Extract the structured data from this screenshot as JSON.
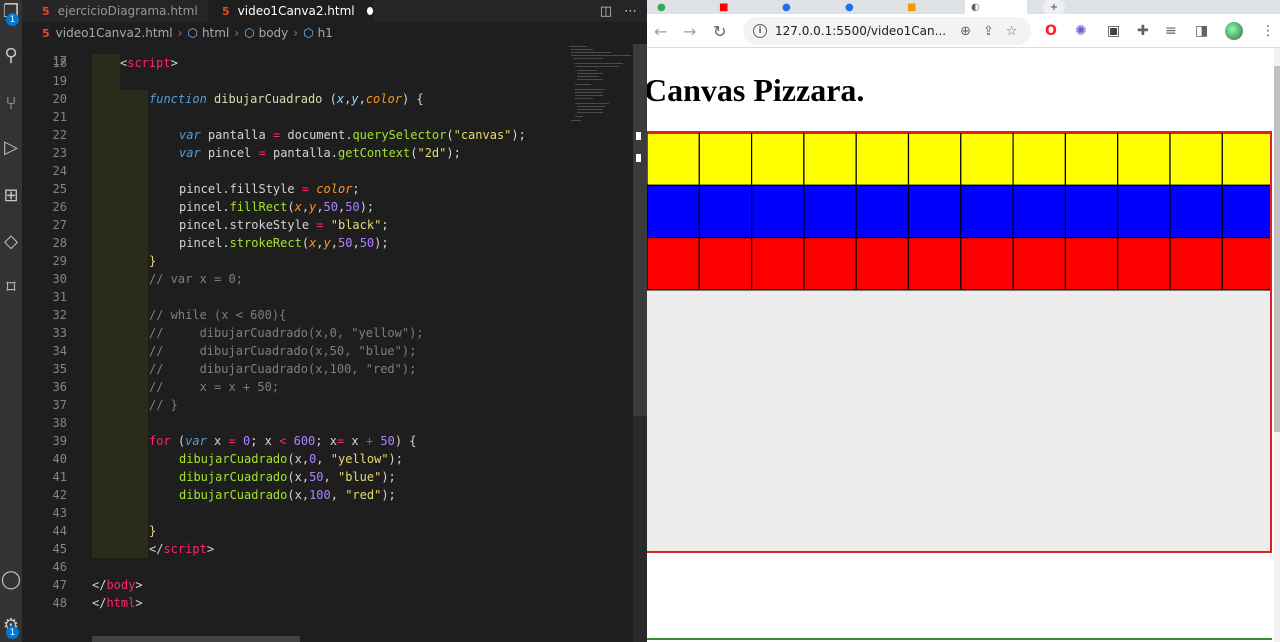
{
  "editor": {
    "tabs": [
      {
        "label": "ejercicioDiagrama.html",
        "active": false
      },
      {
        "label": "video1Canva2.html",
        "active": true,
        "modified": true
      }
    ],
    "breadcrumb": [
      "video1Canva2.html",
      "html",
      "body",
      "h1"
    ],
    "activity_badges": [
      "1",
      "1"
    ],
    "partial_top_line_number": "17",
    "lines": [
      {
        "n": "18",
        "html": "<span class='o'>&lt;</span><span class='t'>script</span><span class='o'>&gt;</span>",
        "indent": 1
      },
      {
        "n": "19",
        "html": "",
        "indent": 0
      },
      {
        "n": "20",
        "html": "<span class='k'>function</span> <span class='f'>dibujarCuadrado</span> <span class='o'>(</span><span class='p'>x</span>,<span class='p'>y</span>,<span class='p' style='color:#fd971f'>color</span><span class='o'>) {</span>",
        "indent": 2
      },
      {
        "n": "21",
        "html": "",
        "indent": 0
      },
      {
        "n": "22",
        "html": "<span class='k'>var</span> <span class='v'>pantalla</span> <span class='t'>=</span> document.<span class='m'>querySelector</span>(<span class='s' style='color:#e6db74'>\"canvas\"</span>);",
        "indent": 3
      },
      {
        "n": "23",
        "html": "<span class='k'>var</span> <span class='v'>pincel</span> <span class='t'>=</span> pantalla.<span class='m'>getContext</span>(<span class='s' style='color:#e6db74'>\"2d\"</span>);",
        "indent": 3
      },
      {
        "n": "24",
        "html": "",
        "indent": 0
      },
      {
        "n": "25",
        "html": "pincel.fillStyle <span class='t'>=</span> <span class='p' style='color:#fd971f'>color</span>;",
        "indent": 3
      },
      {
        "n": "26",
        "html": "pincel.<span class='m'>fillRect</span>(<span class='p' style='color:#fd971f'>x</span>,<span class='p' style='color:#fd971f'>y</span>,<span class='n' style='color:#ae81ff'>50</span>,<span class='n' style='color:#ae81ff'>50</span>);",
        "indent": 3
      },
      {
        "n": "27",
        "html": "pincel.strokeStyle <span class='t'>=</span> <span class='s' style='color:#e6db74'>\"black\"</span>;",
        "indent": 3
      },
      {
        "n": "28",
        "html": "pincel.<span class='m'>strokeRect</span>(<span class='p' style='color:#fd971f'>x</span>,<span class='p' style='color:#fd971f'>y</span>,<span class='n' style='color:#ae81ff'>50</span>,<span class='n' style='color:#ae81ff'>50</span>);",
        "indent": 3
      },
      {
        "n": "29",
        "html": "<span style='color:#e6db74'>}</span>",
        "indent": 2
      },
      {
        "n": "30",
        "html": "<span class='cm'>// var x = 0;</span>",
        "indent": 2
      },
      {
        "n": "31",
        "html": "",
        "indent": 0
      },
      {
        "n": "32",
        "html": "<span class='cm'>// while (x &lt; 600){</span>",
        "indent": 2
      },
      {
        "n": "33",
        "html": "<span class='cm'>//     dibujarCuadrado(x,0, \"yellow\");</span>",
        "indent": 2
      },
      {
        "n": "34",
        "html": "<span class='cm'>//     dibujarCuadrado(x,50, \"blue\");</span>",
        "indent": 2
      },
      {
        "n": "35",
        "html": "<span class='cm'>//     dibujarCuadrado(x,100, \"red\");</span>",
        "indent": 2
      },
      {
        "n": "36",
        "html": "<span class='cm'>//     x = x + 50;</span>",
        "indent": 2
      },
      {
        "n": "37",
        "html": "<span class='cm'>// }</span>",
        "indent": 2
      },
      {
        "n": "38",
        "html": "",
        "indent": 0
      },
      {
        "n": "39",
        "html": "<span class='t'>for</span> (<span class='k'>var</span> x <span class='t'>=</span> <span style='color:#ae81ff'>0</span>; x <span class='t'>&lt;</span> <span style='color:#ae81ff'>600</span>; x<span class='t'>=</span> x <span class='t'>+</span> <span style='color:#ae81ff'>50</span>) {",
        "indent": 2
      },
      {
        "n": "40",
        "html": "<span class='m'>dibujarCuadrado</span>(x,<span style='color:#ae81ff'>0</span>, <span style='color:#e6db74'>\"yellow\"</span>);",
        "indent": 3
      },
      {
        "n": "41",
        "html": "<span class='m'>dibujarCuadrado</span>(x,<span style='color:#ae81ff'>50</span>, <span style='color:#e6db74'>\"blue\"</span>);",
        "indent": 3
      },
      {
        "n": "42",
        "html": "<span class='m'>dibujarCuadrado</span>(x,<span style='color:#ae81ff'>100</span>, <span style='color:#e6db74'>\"red\"</span>);",
        "indent": 3
      },
      {
        "n": "43",
        "html": "",
        "indent": 0
      },
      {
        "n": "44",
        "html": "<span style='color:#e6db74'>}</span>",
        "indent": 2
      },
      {
        "n": "45",
        "html": "<span class='o'>&lt;/</span><span class='t'>script</span><span class='o'>&gt;</span>",
        "indent": 2
      },
      {
        "n": "46",
        "html": "",
        "indent": 0
      },
      {
        "n": "47",
        "html": "<span class='o'>&lt;/</span><span class='t'>body</span><span class='o'>&gt;</span>",
        "indent": 0
      },
      {
        "n": "48",
        "html": "<span class='o'>&lt;/</span><span class='t'>html</span><span class='o'>&gt;</span>",
        "indent": 0
      }
    ]
  },
  "browser": {
    "url": "127.0.0.1:5500/video1Can...",
    "page_title": "Canvas Pizzara.",
    "canvas": {
      "rows": [
        {
          "color": "#ffff00"
        },
        {
          "color": "#0000ff"
        },
        {
          "color": "#ff0000"
        }
      ],
      "columns_visible": 12,
      "square_size": 50,
      "background": "#ececec",
      "border_color": "#e02020"
    }
  }
}
